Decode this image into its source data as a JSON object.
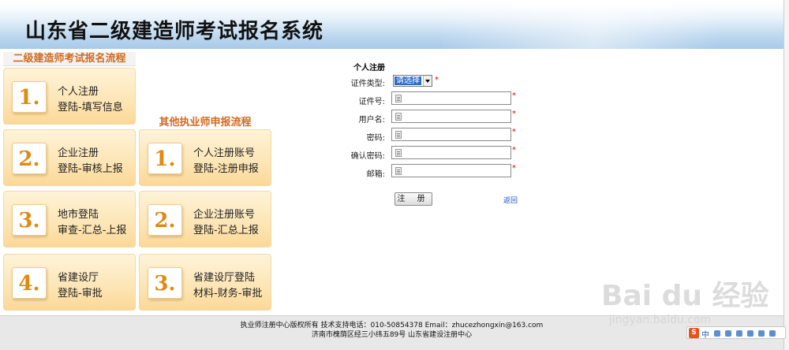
{
  "header": {
    "title": "山东省二级建造师考试报名系统"
  },
  "left_flow": {
    "heading": "二级建造师考试报名流程",
    "steps": [
      {
        "num": "1.",
        "line1": "个人注册",
        "line2": "登陆-填写信息"
      },
      {
        "num": "2.",
        "line1": "企业注册",
        "line2": "登陆-审核上报"
      },
      {
        "num": "3.",
        "line1": "地市登陆",
        "line2": "审查-汇总-上报"
      },
      {
        "num": "4.",
        "line1": "省建设厅",
        "line2": "登陆-审批"
      }
    ]
  },
  "right_flow": {
    "heading": "其他执业师申报流程",
    "steps": [
      {
        "num": "1.",
        "line1": "个人注册账号",
        "line2": "登陆-注册申报"
      },
      {
        "num": "2.",
        "line1": "企业注册账号",
        "line2": "登陆-汇总上报"
      },
      {
        "num": "3.",
        "line1": "省建设厅登陆",
        "line2": "材料-财务-审批"
      }
    ]
  },
  "form": {
    "title": "个人注册",
    "id_type_label": "证件类型:",
    "id_type_value": "请选择",
    "id_number_label": "证件号:",
    "username_label": "用户名:",
    "password_label": "密码:",
    "confirm_label": "确认密码:",
    "email_label": "邮箱:",
    "required_mark": "*",
    "register_button": "注 册",
    "back_link": "返回"
  },
  "footer": {
    "line1": "执业师注册中心版权所有 技术支持电话：010-50854378 Email：zhucezhongxin@163.com",
    "line2": "济南市槐荫区经三小纬五89号 山东省建设注册中心"
  },
  "watermark": {
    "brand": "Bai du 经验",
    "url": "jingyan.baidu.com"
  },
  "ime": {
    "logo": "S",
    "mode": "中"
  },
  "colors": {
    "accent_orange": "#d2691e",
    "step_bg": "#fde5b4",
    "link_blue": "#1a4fc4",
    "required_red": "#e00000",
    "header_blue": "#a7c9e8"
  }
}
